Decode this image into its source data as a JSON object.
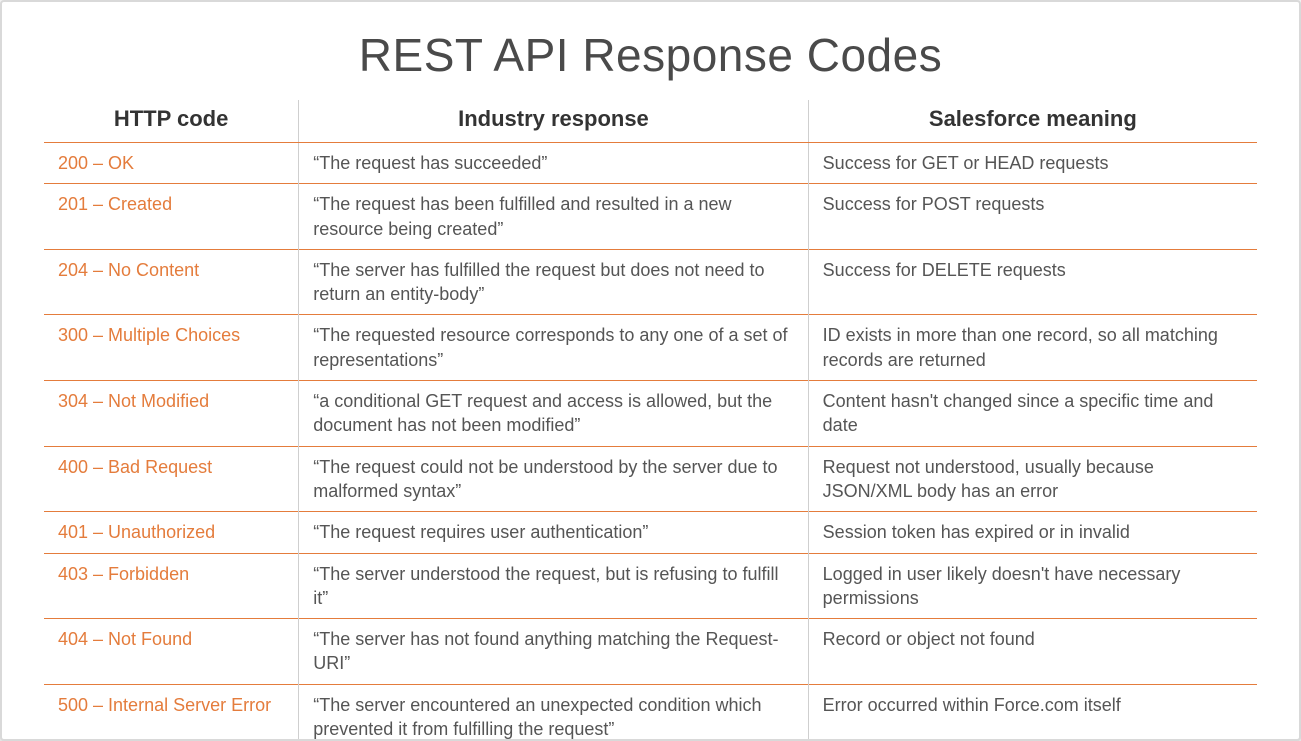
{
  "title": "REST API Response Codes",
  "columns": {
    "http_code": "HTTP code",
    "industry_response": "Industry response",
    "salesforce_meaning": "Salesforce meaning"
  },
  "rows": [
    {
      "code": "200 – OK",
      "response": "“The request has succeeded”",
      "meaning": "Success for GET or HEAD requests"
    },
    {
      "code": "201 – Created",
      "response": "“The request has been fulfilled and resulted in a new resource being created”",
      "meaning": "Success for POST requests"
    },
    {
      "code": "204 – No Content",
      "response": "“The server has fulfilled the request but does not need to return an entity-body”",
      "meaning": "Success for DELETE requests"
    },
    {
      "code": "300 – Multiple Choices",
      "response": "“The requested resource corresponds to any one of a set of representations”",
      "meaning": "ID exists in more than one record, so all matching records are returned"
    },
    {
      "code": "304 – Not Modified",
      "response": "“a conditional GET request and access is allowed, but the document has not been modified”",
      "meaning": "Content hasn't changed since a specific time and date"
    },
    {
      "code": "400 – Bad Request",
      "response": "“The request could not be understood by the server due to malformed syntax”",
      "meaning": "Request not understood, usually because JSON/XML body has an error"
    },
    {
      "code": "401 – Unauthorized",
      "response": "“The request requires user authentication”",
      "meaning": "Session token has expired or in invalid"
    },
    {
      "code": "403 – Forbidden",
      "response": "“The server understood the request, but is refusing to fulfill it”",
      "meaning": "Logged in user likely doesn't have necessary permissions"
    },
    {
      "code": "404 – Not Found",
      "response": "“The server has not found anything matching the Request-URI”",
      "meaning": "Record or object not found"
    },
    {
      "code": "500 – Internal Server Error",
      "response": "“The server encountered an unexpected condition which prevented it from fulfilling the request”",
      "meaning": "Error occurred within Force.com itself"
    }
  ]
}
